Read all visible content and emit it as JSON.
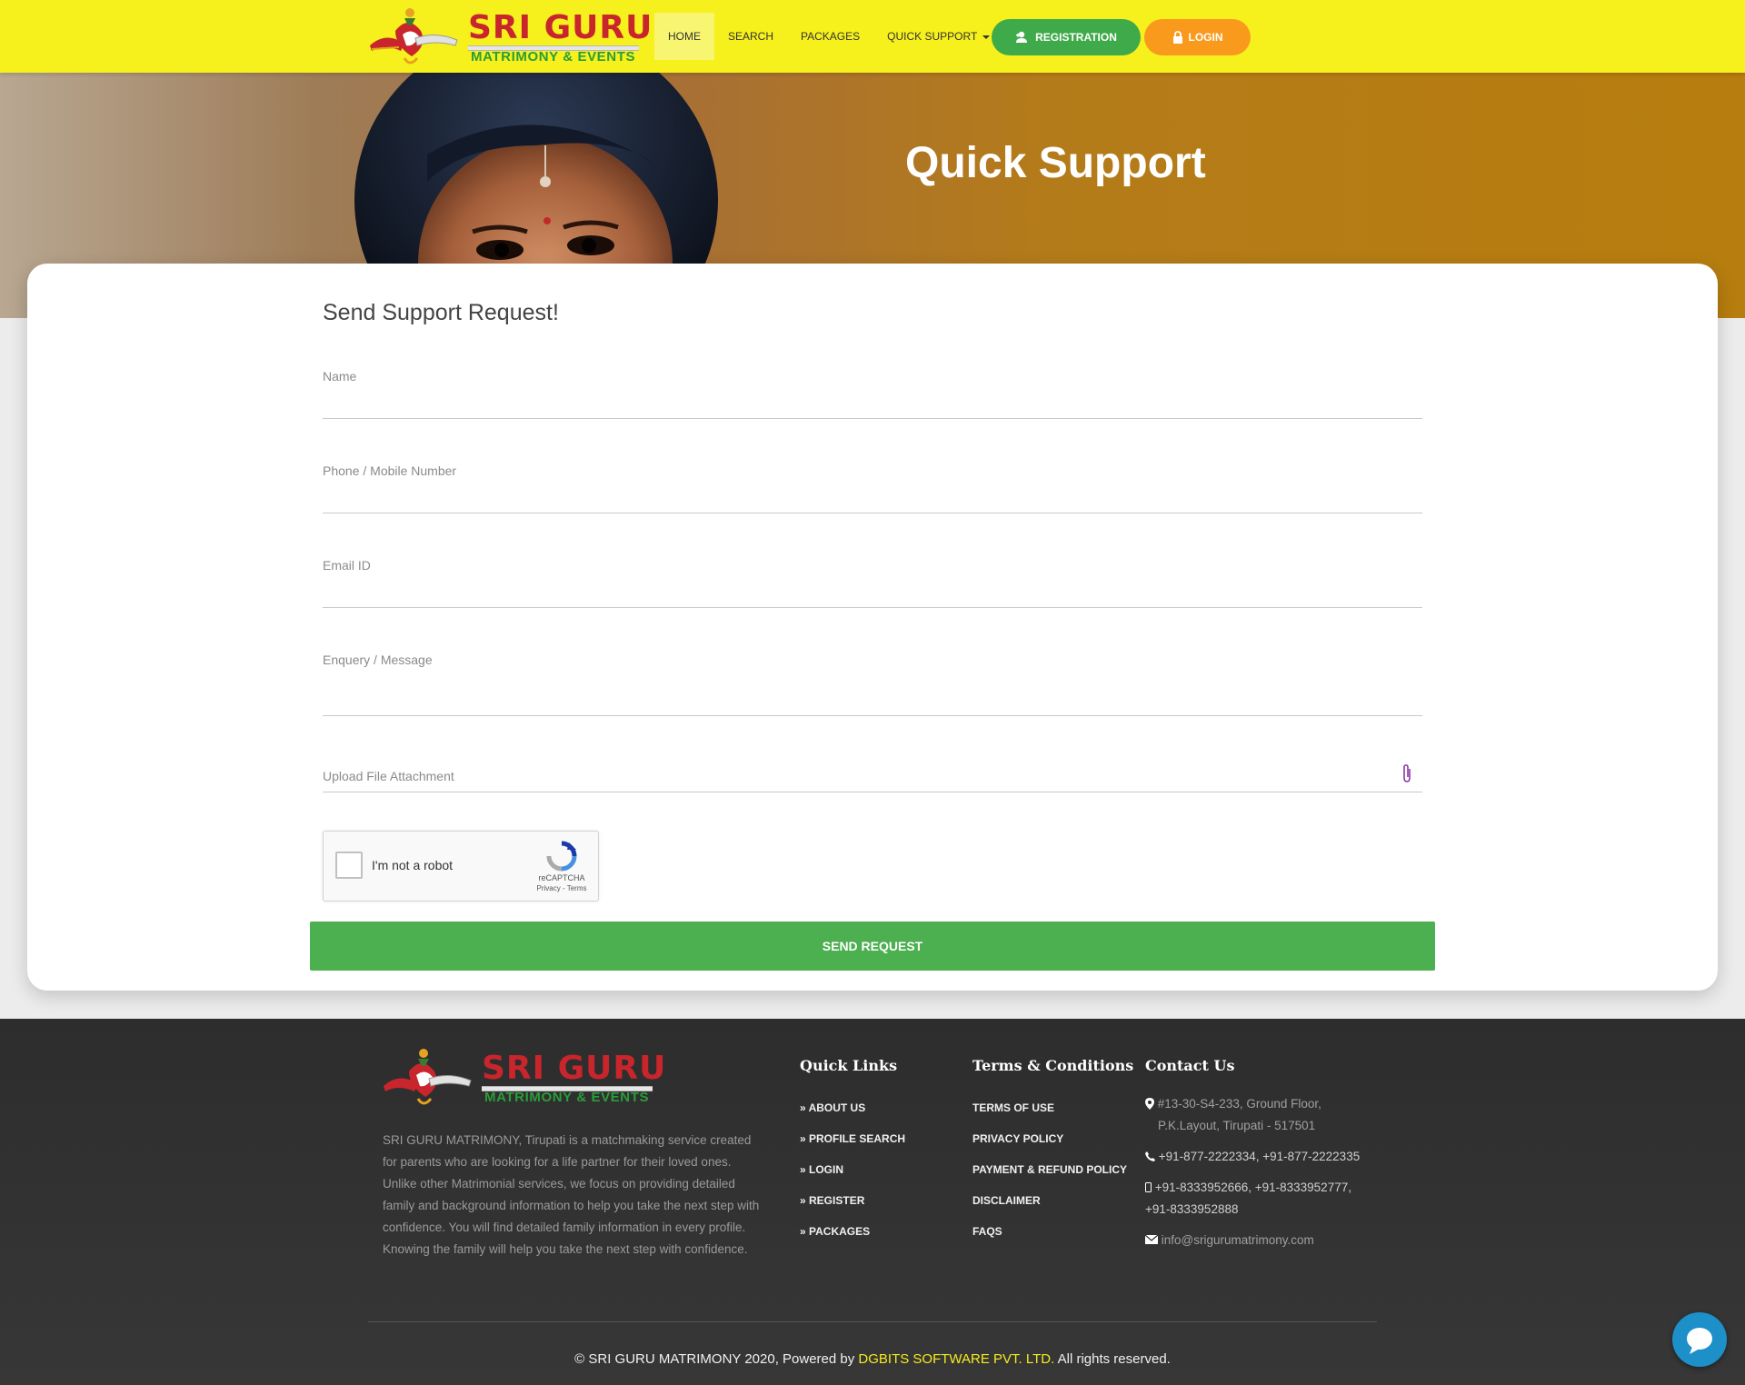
{
  "brand": {
    "name": "SRI GURU",
    "tagline": "MATRIMONY & EVENTS"
  },
  "nav": {
    "items": [
      "HOME",
      "SEARCH",
      "PACKAGES",
      "QUICK SUPPORT"
    ],
    "registration": "REGISTRATION",
    "login": "LOGIN"
  },
  "hero": {
    "title": "Quick Support"
  },
  "form": {
    "heading": "Send Support Request!",
    "name_label": "Name",
    "phone_label": "Phone / Mobile Number",
    "email_label": "Email ID",
    "message_label": "Enquery / Message",
    "upload_label": "Upload File Attachment",
    "submit": "SEND REQUEST"
  },
  "recaptcha": {
    "label": "I'm not a robot",
    "brand": "reCAPTCHA",
    "terms": "Privacy - Terms"
  },
  "footer": {
    "about": "SRI GURU MATRIMONY, Tirupati is a matchmaking service created for parents who are looking for a life partner for their loved ones. Unlike other Matrimonial services, we focus on providing detailed family and background information to help you take the next step with confidence. You will find detailed family information in every profile. Knowing the family will help you take the next step with confidence.",
    "quick_links_title": "Quick Links",
    "quick_links": [
      "ABOUT US",
      "PROFILE SEARCH",
      "LOGIN",
      "REGISTER",
      "PACKAGES"
    ],
    "terms_title": "Terms & Conditions",
    "terms_links": [
      "TERMS OF USE",
      "PRIVACY POLICY",
      "PAYMENT & REFUND POLICY",
      "DISCLAIMER",
      "FAQS"
    ],
    "contact_title": "Contact Us",
    "address_line1": "#13-30-S4-233, Ground Floor,",
    "address_line2": "P.K.Layout, Tirupati - 517501",
    "phone": "+91-877-2222334, +91-877-2222335",
    "mobile_line1": "+91-8333952666, +91-8333952777,",
    "mobile_line2": "+91-8333952888",
    "email": "info@srigurumatrimony.com",
    "copyright_prefix": "© SRI GURU MATRIMONY 2020, Powered by ",
    "copyright_company": "DGBITS SOFTWARE PVT. LTD.",
    "copyright_suffix": " All rights reserved."
  },
  "colors": {
    "navbar": "#f6f01c",
    "primary_green": "#4caf50",
    "registration_green": "#3faa49",
    "login_orange": "#f99a1c",
    "brand_red": "#c8252c",
    "footer_bg": "#2d2d2d",
    "footer_accent": "#f6ec1c",
    "chat_blue": "#1d8fc9"
  },
  "icons": [
    "user-plus-icon",
    "lock-icon",
    "paperclip-icon",
    "recaptcha-icon",
    "chevron-right-icon",
    "map-marker-icon",
    "phone-icon",
    "mobile-icon",
    "envelope-icon",
    "chat-icon"
  ]
}
